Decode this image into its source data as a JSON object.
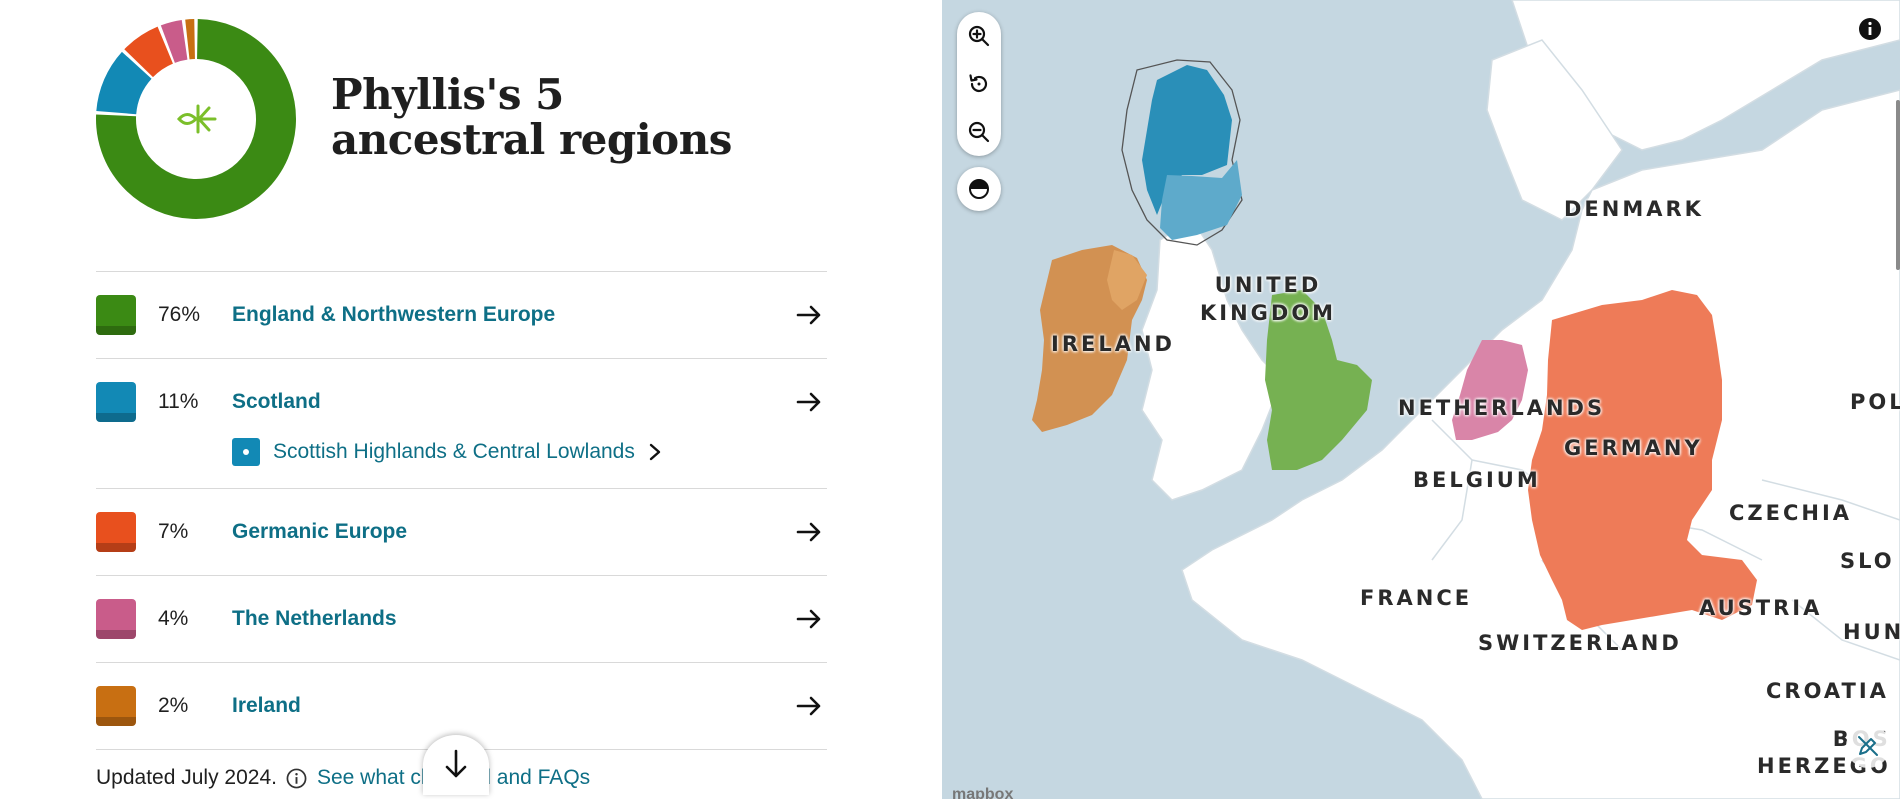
{
  "summary": {
    "title": "Phyllis's 5 ancestral regions",
    "logo_icon": "leaf-logo-icon"
  },
  "regions": [
    {
      "percent": "76%",
      "name": "England & Northwestern Europe",
      "color": "#3b8a14",
      "value": 76
    },
    {
      "percent": "11%",
      "name": "Scotland",
      "color": "#1289b5",
      "value": 11,
      "subregion": "Scottish Highlands & Central Lowlands"
    },
    {
      "percent": "7%",
      "name": "Germanic Europe",
      "color": "#e8501e",
      "value": 7
    },
    {
      "percent": "4%",
      "name": "The Netherlands",
      "color": "#c95c8a",
      "value": 4
    },
    {
      "percent": "2%",
      "name": "Ireland",
      "color": "#c86f12",
      "value": 2
    }
  ],
  "footer": {
    "updated": "Updated July 2024.",
    "link": "See what changed and FAQs"
  },
  "map": {
    "labels": {
      "denmark": "DENMARK",
      "uk": "UNITED\nKINGDOM",
      "ireland": "IRELAND",
      "netherlands": "NETHERLANDS",
      "germany": "GERMANY",
      "belgium": "BELGIUM",
      "czechia": "CZECHIA",
      "france": "FRANCE",
      "austria": "AUSTRIA",
      "switzerland": "SWITZERLAND",
      "poland": "POL",
      "slovakia": "SLO",
      "hungary": "HUN",
      "croatia": "CROATIA",
      "bosnia": "BOS\nHERZEGO"
    },
    "attribution": "mapbox"
  }
}
